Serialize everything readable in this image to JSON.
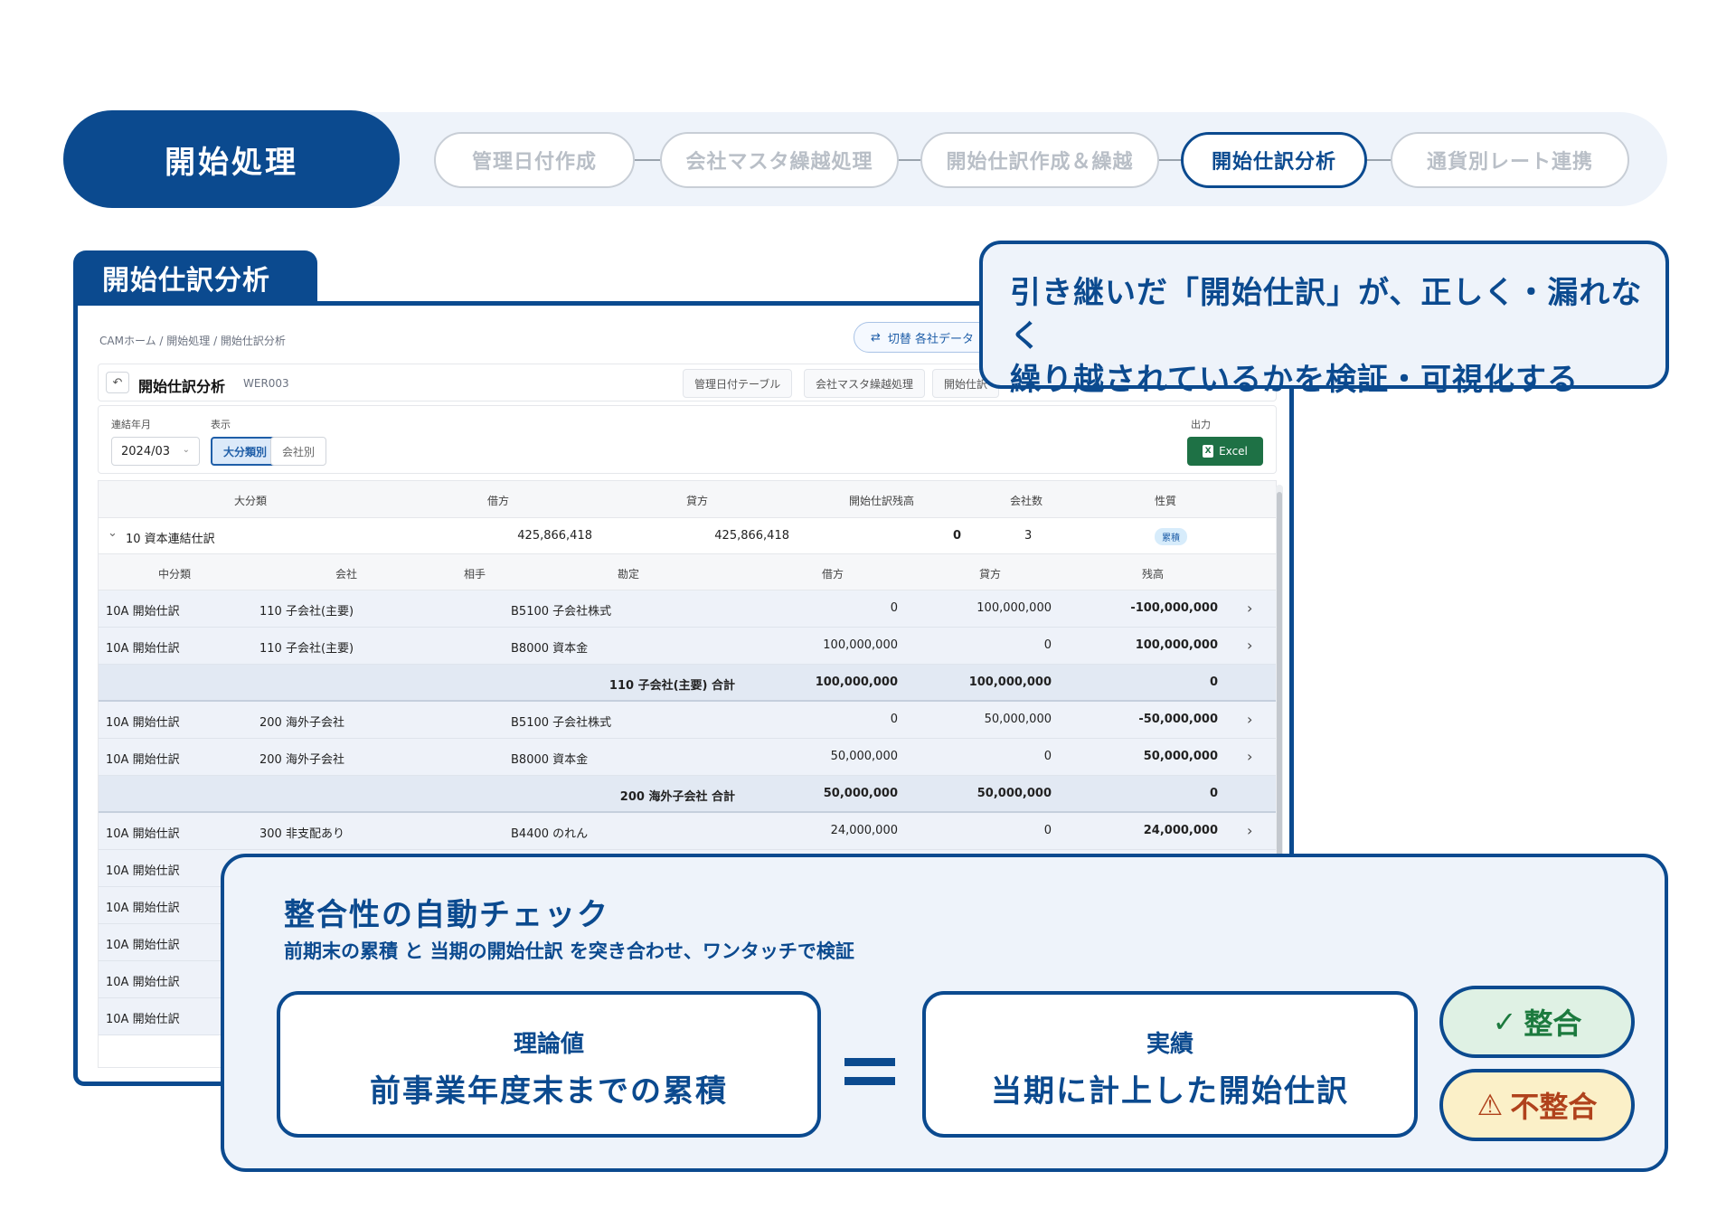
{
  "steps": {
    "main": "開始処理",
    "items": [
      {
        "label": "管理日付作成"
      },
      {
        "label": "会社マスタ繰越処理"
      },
      {
        "label": "開始仕訳作成＆繰越"
      },
      {
        "label": "開始仕訳分析",
        "active": true
      },
      {
        "label": "通貨別レート連携"
      }
    ]
  },
  "frame_tab": "開始仕訳分析",
  "app": {
    "breadcrumb": "CAMホーム / 開始処理 / 開始仕訳分析",
    "switch_icon": "⇄",
    "switch_label": "切替  各社データ",
    "back_icon": "↶",
    "title": "開始仕訳分析",
    "code": "WER003",
    "nav": [
      "管理日付テーブル",
      "会社マスタ繰越処理",
      "開始仕訳"
    ],
    "filters": {
      "period_label": "連結年月",
      "period_value": "2024/03",
      "display_label": "表示",
      "seg_on": "大分類別",
      "seg_off": "会社別",
      "output_label": "出力",
      "excel": "Excel"
    },
    "grid": {
      "head": {
        "c1": "大分類",
        "c2": "借方",
        "c3": "貸方",
        "c4": "開始仕訳残高",
        "c5": "会社数",
        "c6": "性質"
      },
      "group": {
        "chev": "⌄",
        "name": "10 資本連結仕訳",
        "debit": "425,866,418",
        "credit": "425,866,418",
        "balance": "0",
        "count": "3",
        "badge": "累積"
      },
      "subhead": {
        "c1": "中分類",
        "c2": "会社",
        "c3": "相手",
        "c4": "勘定",
        "c5": "借方",
        "c6": "貸方",
        "c7": "残高"
      },
      "rows": [
        {
          "type": "data",
          "mid": "10A 開始仕訳",
          "company": "110 子会社(主要)",
          "account": "B5100 子会社株式",
          "debit": "0",
          "credit": "100,000,000",
          "balance": "-100,000,000",
          "arrow": "›"
        },
        {
          "type": "data",
          "mid": "10A 開始仕訳",
          "company": "110 子会社(主要)",
          "account": "B8000 資本金",
          "debit": "100,000,000",
          "credit": "0",
          "balance": "100,000,000",
          "arrow": "›"
        },
        {
          "type": "total",
          "label": "110 子会社(主要) 合計",
          "debit": "100,000,000",
          "credit": "100,000,000",
          "balance": "0"
        },
        {
          "type": "data",
          "mid": "10A 開始仕訳",
          "company": "200 海外子会社",
          "account": "B5100 子会社株式",
          "debit": "0",
          "credit": "50,000,000",
          "balance": "-50,000,000",
          "arrow": "›"
        },
        {
          "type": "data",
          "mid": "10A 開始仕訳",
          "company": "200 海外子会社",
          "account": "B8000 資本金",
          "debit": "50,000,000",
          "credit": "0",
          "balance": "50,000,000",
          "arrow": "›"
        },
        {
          "type": "total",
          "label": "200 海外子会社 合計",
          "debit": "50,000,000",
          "credit": "50,000,000",
          "balance": "0"
        },
        {
          "type": "data",
          "mid": "10A 開始仕訳",
          "company": "300 非支配あり",
          "account": "B4400 のれん",
          "debit": "24,000,000",
          "credit": "0",
          "balance": "24,000,000",
          "arrow": "›"
        },
        {
          "type": "data",
          "mid": "10A 開始仕訳",
          "company": "",
          "account": "",
          "debit": "",
          "credit": "",
          "balance": "",
          "arrow": ""
        },
        {
          "type": "data",
          "mid": "10A 開始仕訳",
          "company": "",
          "account": "",
          "debit": "",
          "credit": "",
          "balance": "",
          "arrow": ""
        },
        {
          "type": "data",
          "mid": "10A 開始仕訳",
          "company": "",
          "account": "",
          "debit": "",
          "credit": "",
          "balance": "",
          "arrow": ""
        },
        {
          "type": "data",
          "mid": "10A 開始仕訳",
          "company": "",
          "account": "",
          "debit": "",
          "credit": "",
          "balance": "",
          "arrow": ""
        },
        {
          "type": "data",
          "mid": "10A 開始仕訳",
          "company": "",
          "account": "",
          "debit": "",
          "credit": "",
          "balance": "",
          "arrow": ""
        }
      ]
    }
  },
  "callout": {
    "line1": "引き継いだ「開始仕訳」が、正しく・漏れなく",
    "line2": "繰り越されているかを検証・可視化する"
  },
  "check": {
    "title": "整合性の自動チェック",
    "subtitle": "前期末の累積 と 当期の開始仕訳 を突き合わせ、ワンタッチで検証",
    "left": {
      "t1": "理論値",
      "t2": "前事業年度末までの累積"
    },
    "right": {
      "t1": "実績",
      "t2": "当期に計上した開始仕訳"
    },
    "ok": {
      "icon": "✓",
      "label": "整合"
    },
    "ng": {
      "icon": "⚠",
      "label": "不整合"
    }
  },
  "colors": {
    "brand": "#0b4a8f",
    "excel": "#1e7145",
    "ok": "#1c7a3e",
    "ng": "#b0421c"
  }
}
